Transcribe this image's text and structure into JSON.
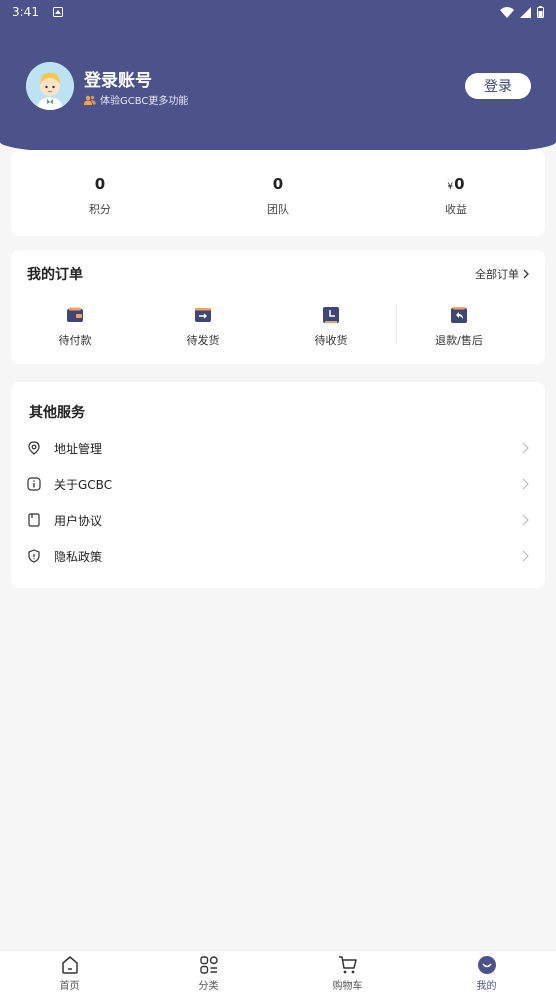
{
  "status_bar": {
    "time": "3:41"
  },
  "profile": {
    "title": "登录账号",
    "subtitle": "体验GCBC更多功能",
    "login_button": "登录"
  },
  "stats": [
    {
      "value": "0",
      "label": "积分"
    },
    {
      "value": "0",
      "label": "团队"
    },
    {
      "currency": "¥",
      "value": "0",
      "label": "收益"
    }
  ],
  "orders": {
    "title": "我的订单",
    "all_label": "全部订单",
    "items": [
      {
        "label": "待付款",
        "icon": "wallet-icon"
      },
      {
        "label": "待发货",
        "icon": "ship-icon"
      },
      {
        "label": "待收货",
        "icon": "clock-icon"
      },
      {
        "label": "退款/售后",
        "icon": "refund-icon"
      }
    ]
  },
  "services": {
    "title": "其他服务",
    "items": [
      {
        "label": "地址管理",
        "icon": "location-icon"
      },
      {
        "label": "关于GCBC",
        "icon": "info-icon"
      },
      {
        "label": "用户协议",
        "icon": "document-icon"
      },
      {
        "label": "隐私政策",
        "icon": "shield-icon"
      }
    ]
  },
  "tabbar": [
    {
      "label": "首页",
      "icon": "home-icon"
    },
    {
      "label": "分类",
      "icon": "category-icon"
    },
    {
      "label": "购物车",
      "icon": "cart-icon"
    },
    {
      "label": "我的",
      "icon": "profile-icon",
      "active": true
    }
  ],
  "colors": {
    "primary": "#4b538a",
    "background": "#f6f6f6",
    "card": "#ffffff"
  }
}
